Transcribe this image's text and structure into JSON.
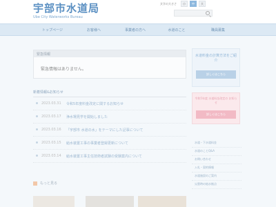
{
  "header": {
    "logo_title": "宇部市水道局",
    "logo_sub": "Ube City Waterworks Bureau",
    "fontsize_label": "文字の大きさ",
    "fontsize_options": [
      "小",
      "中",
      "大"
    ],
    "search_placeholder": ""
  },
  "nav": {
    "items": [
      "トップページ",
      "お客様へ",
      "事業者の方へ",
      "水道のこと",
      "職員募集"
    ]
  },
  "main": {
    "emergency_heading": "緊急情報",
    "emergency_text": "緊急情報はありません。",
    "news_heading": "新着情報&お知らせ",
    "news": [
      {
        "date": "2023.03.31",
        "text": "令和5年度料金改定に関するお知らせ"
      },
      {
        "date": "2023.03.17",
        "text": "浄水場見学を開始しました"
      },
      {
        "date": "2023.03.16",
        "text": "「宇部市 水道の水」をテーマにした記事について"
      },
      {
        "date": "2023.03.15",
        "text": "給水装置工事の事業者登録更新について"
      },
      {
        "date": "2023.03.14",
        "text": "給水装置工事主任技術者試験の受験案内について"
      }
    ],
    "rss_label": "もっと見る"
  },
  "sidebar": {
    "card1_text": "水道料金の計算方法をご紹介",
    "card1_button": "詳しくはこちら",
    "card2_text": "令和5年度 水道料金改定の お知らせ",
    "card2_button": "詳しくはこちら",
    "links": [
      "水道・下水道料金",
      "水道のことQ&A",
      "お問い合わせ",
      "入札・契約情報",
      "水道施設のご案内",
      "災害時の給水拠点"
    ]
  }
}
